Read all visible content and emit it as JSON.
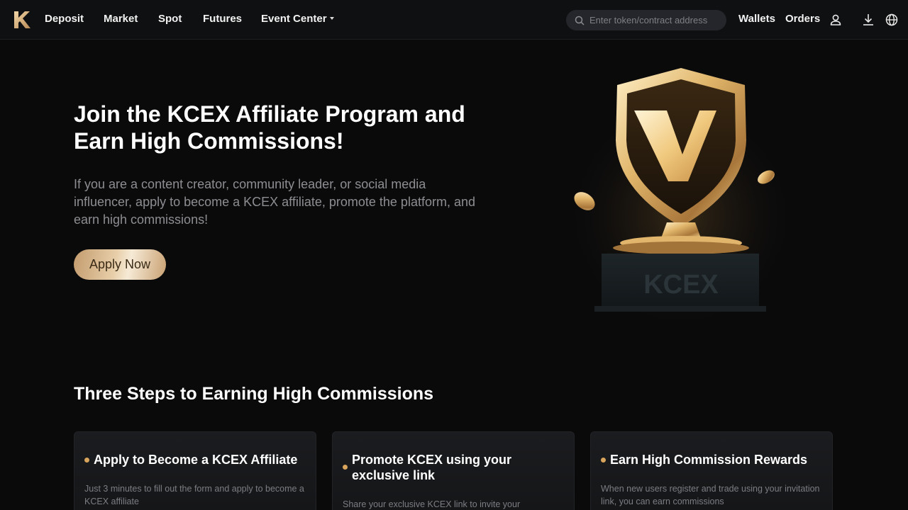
{
  "nav": {
    "logo_icon": "kcex-logo-icon",
    "items": [
      {
        "label": "Deposit"
      },
      {
        "label": "Market"
      },
      {
        "label": "Spot"
      },
      {
        "label": "Futures"
      },
      {
        "label": "Event Center"
      }
    ],
    "search_placeholder": "Enter token/contract address",
    "wallets": "Wallets",
    "orders": "Orders",
    "icons": [
      "user-icon",
      "download-icon",
      "globe-icon"
    ]
  },
  "hero": {
    "title": "Join the KCEX Affiliate Program and Earn High Commissions!",
    "description": "If you are a content creator, community leader, or social media influencer, apply to become a KCEX affiliate, promote the platform, and earn high commissions!",
    "apply_button": "Apply Now",
    "trophy_letter": "V",
    "trophy_base_text": "KCEX"
  },
  "steps": {
    "title": "Three Steps to Earning High Commissions",
    "cards": [
      {
        "title": "Apply to Become a KCEX Affiliate",
        "text": "Just 3 minutes to fill out the form and apply to become a KCEX affiliate"
      },
      {
        "title": "Promote KCEX using your exclusive link",
        "text": "Share your exclusive KCEX link to invite your"
      },
      {
        "title": "Earn High Commission Rewards",
        "text": "When new users register and trade using your invitation link, you can earn commissions"
      }
    ]
  },
  "colors": {
    "accent_gold": "#d9a55c",
    "background": "#0a0a0b",
    "nav_background": "#0f1012"
  }
}
